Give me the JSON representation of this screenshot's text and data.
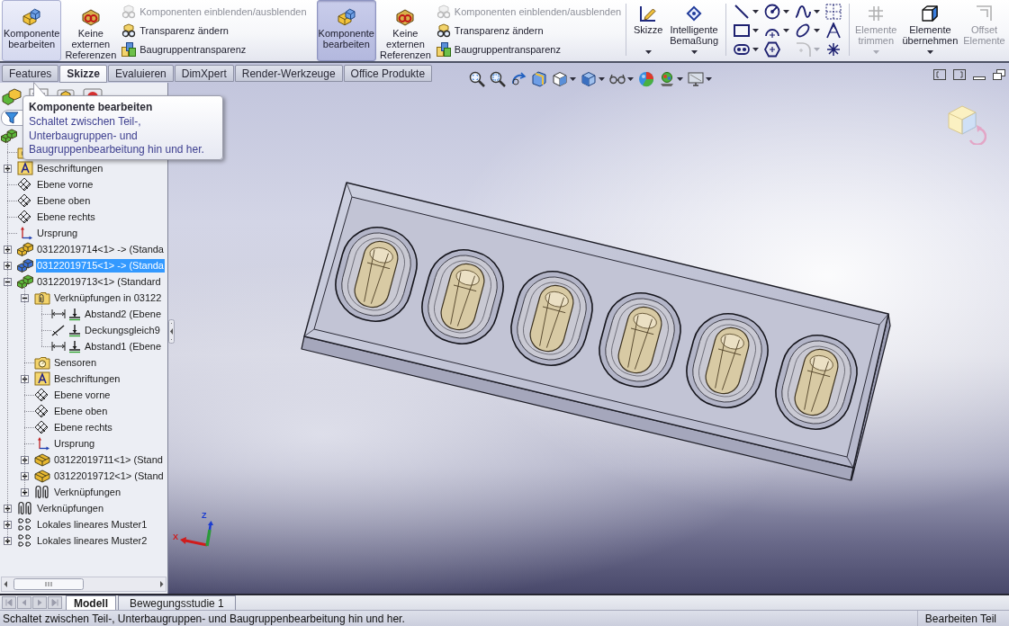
{
  "ribbon": {
    "groups": [
      {
        "kind": "assembly",
        "buttons": [
          {
            "label": "Komponente bearbeiten",
            "hovered": true,
            "pressed": false
          },
          {
            "label": "Keine externen Referenzen",
            "hovered": false,
            "pressed": false
          }
        ],
        "stack": [
          {
            "label": "Komponenten einblenden/ausblenden",
            "disabled": true
          },
          {
            "label": "Transparenz ändern",
            "disabled": false
          },
          {
            "label": "Baugruppentransparenz",
            "disabled": false
          }
        ]
      },
      {
        "kind": "assembly",
        "buttons": [
          {
            "label": "Komponente bearbeiten",
            "hovered": false,
            "pressed": true
          },
          {
            "label": "Keine externen Referenzen",
            "hovered": false,
            "pressed": false
          }
        ],
        "stack": [
          {
            "label": "Komponenten einblenden/ausblenden",
            "disabled": true
          },
          {
            "label": "Transparenz ändern",
            "disabled": false
          },
          {
            "label": "Baugruppentransparenz",
            "disabled": false
          }
        ]
      },
      {
        "kind": "sketch",
        "buttons": [
          {
            "label": "Skizze",
            "dropdown": true
          },
          {
            "label": "Intelligente Bemaßung",
            "dropdown": true
          }
        ],
        "tools": [
          {
            "dropdown": true,
            "disabled": false
          },
          {
            "dropdown": true,
            "disabled": false
          },
          {
            "dropdown": true,
            "disabled": false
          },
          {
            "dropdown": false,
            "disabled": false
          },
          {
            "dropdown": true,
            "disabled": false
          },
          {
            "dropdown": true,
            "disabled": false
          },
          {
            "dropdown": true,
            "disabled": false
          },
          {
            "dropdown": false,
            "disabled": false
          },
          {
            "dropdown": true,
            "disabled": false
          },
          {
            "dropdown": false,
            "disabled": false
          },
          {
            "dropdown": true,
            "disabled": true
          },
          {
            "dropdown": false,
            "disabled": false
          }
        ]
      },
      {
        "kind": "edit",
        "buttons": [
          {
            "label": "Elemente trimmen",
            "dropdown": true,
            "disabled": true
          },
          {
            "label": "Elemente übernehmen",
            "dropdown": true,
            "disabled": false
          },
          {
            "label": "Offset Elemente",
            "dropdown": false,
            "disabled": true
          }
        ]
      }
    ]
  },
  "command_tabs": [
    {
      "label": "Features",
      "selected": false
    },
    {
      "label": "Skizze",
      "selected": true
    },
    {
      "label": "Evaluieren",
      "selected": false
    },
    {
      "label": "DimXpert",
      "selected": false
    },
    {
      "label": "Render-Werkzeuge",
      "selected": false
    },
    {
      "label": "Office Produkte",
      "selected": false
    }
  ],
  "view_toolbar": [
    {
      "dropdown": false
    },
    {
      "dropdown": false
    },
    {
      "dropdown": false
    },
    {
      "dropdown": false
    },
    {
      "dropdown": true
    },
    {
      "dropdown": true
    },
    {
      "dropdown": true
    },
    {
      "dropdown": false
    },
    {
      "dropdown": true
    },
    {
      "dropdown": true
    }
  ],
  "feature_manager": {
    "tree": [
      {
        "kind": "assembly",
        "color": "#5cb83a",
        "selected": false,
        "children": [
          {
            "kind": "sensors",
            "selected": false
          },
          {
            "kind": "annotations",
            "label": "Beschriftungen",
            "expanded": false,
            "selected": false
          },
          {
            "kind": "plane",
            "label": "Ebene vorne",
            "selected": false
          },
          {
            "kind": "plane",
            "label": "Ebene oben",
            "selected": false
          },
          {
            "kind": "plane",
            "label": "Ebene rechts",
            "selected": false
          },
          {
            "kind": "origin",
            "label": "Ursprung",
            "selected": false
          },
          {
            "kind": "assembly",
            "label": "03122019714<1> -> (Standa",
            "color": "#e8b830",
            "expanded": false,
            "selected": false
          },
          {
            "kind": "assembly",
            "label": "03122019715<1> -> (Standa",
            "color": "#3a6fd8",
            "expanded": false,
            "selected": true
          },
          {
            "kind": "assembly",
            "label": "03122019713<1> (Standard",
            "color": "#5cb83a",
            "expanded": true,
            "selected": false,
            "children": [
              {
                "kind": "mate_folder",
                "label": "Verknüpfungen in 03122",
                "expanded": true,
                "selected": false,
                "children": [
                  {
                    "kind": "distance_mate",
                    "label": "Abstand2 (Ebene",
                    "selected": false
                  },
                  {
                    "kind": "coincident_mate",
                    "label": "Deckungsgleich9",
                    "selected": false
                  },
                  {
                    "kind": "distance_mate",
                    "label": "Abstand1 (Ebene",
                    "selected": false
                  }
                ]
              },
              {
                "kind": "sensors",
                "label": "Sensoren",
                "selected": false
              },
              {
                "kind": "annotations",
                "label": "Beschriftungen",
                "expanded": false,
                "selected": false
              },
              {
                "kind": "plane",
                "label": "Ebene vorne",
                "selected": false
              },
              {
                "kind": "plane",
                "label": "Ebene oben",
                "selected": false
              },
              {
                "kind": "plane",
                "label": "Ebene rechts",
                "selected": false
              },
              {
                "kind": "origin",
                "label": "Ursprung",
                "selected": false
              },
              {
                "kind": "part",
                "label": "03122019711<1> (Stand",
                "color": "#e8b830",
                "expanded": false,
                "selected": false
              },
              {
                "kind": "part",
                "label": "03122019712<1> (Stand",
                "color": "#e8b830",
                "expanded": false,
                "selected": false
              },
              {
                "kind": "mates",
                "label": "Verknüpfungen",
                "expanded": false,
                "selected": false
              }
            ]
          },
          {
            "kind": "mates",
            "label": "Verknüpfungen",
            "expanded": false,
            "selected": false
          },
          {
            "kind": "pattern",
            "label": "Lokales lineares Muster1",
            "expanded": false,
            "selected": false
          },
          {
            "kind": "pattern",
            "label": "Lokales lineares Muster2",
            "expanded": false,
            "selected": false
          }
        ]
      }
    ]
  },
  "tooltip": {
    "title": "Komponente bearbeiten",
    "text": "Schaltet zwischen Teil-, Unterbaugruppen- und Baugruppenbearbeitung hin und her."
  },
  "axis_triad": {
    "labels": [
      {
        "text": "X",
        "color": "#d01c1c"
      },
      {
        "text": "Z",
        "color": "#1c3cd0"
      }
    ]
  },
  "bottom_tabs": [
    {
      "label": "Modell",
      "selected": true
    },
    {
      "label": "Bewegungsstudie 1",
      "selected": false
    }
  ],
  "status_bar": {
    "message": "Schaltet zwischen Teil-, Unterbaugruppen- und Baugruppenbearbeitung hin und her.",
    "mode": "Bearbeiten Teil"
  }
}
